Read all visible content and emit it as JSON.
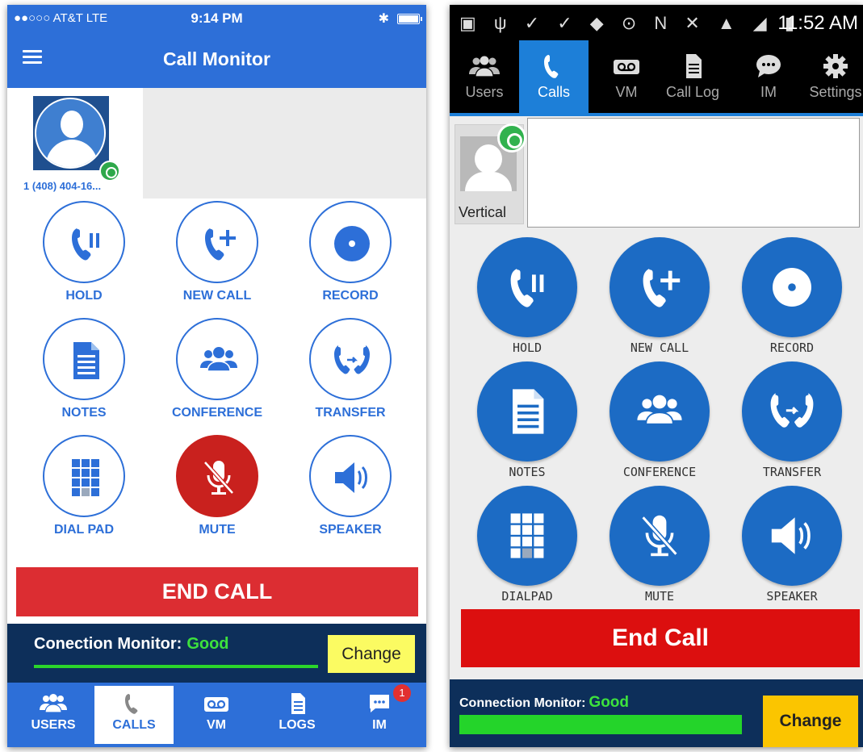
{
  "ios": {
    "status": {
      "carrier": "●●○○○ AT&T  LTE",
      "time": "9:14 PM",
      "bluetooth": "✱"
    },
    "nav": {
      "title": "Call Monitor"
    },
    "caller": {
      "number": "1 (408) 404-16..."
    },
    "buttons": [
      {
        "label": "HOLD",
        "icon": "phone-hold-icon"
      },
      {
        "label": "NEW CALL",
        "icon": "phone-add-icon"
      },
      {
        "label": "RECORD",
        "icon": "record-icon"
      },
      {
        "label": "NOTES",
        "icon": "notes-icon"
      },
      {
        "label": "CONFERENCE",
        "icon": "conference-icon"
      },
      {
        "label": "TRANSFER",
        "icon": "transfer-icon"
      },
      {
        "label": "DIAL PAD",
        "icon": "dialpad-icon"
      },
      {
        "label": "MUTE",
        "icon": "mic-muted-icon",
        "active": true
      },
      {
        "label": "SPEAKER",
        "icon": "speaker-icon"
      }
    ],
    "end_call": "END CALL",
    "connection": {
      "label": "Conection Monitor:",
      "status": "Good",
      "change": "Change"
    },
    "tabs": [
      {
        "label": "USERS",
        "icon": "users-icon"
      },
      {
        "label": "CALLS",
        "icon": "phone-icon",
        "active": true
      },
      {
        "label": "VM",
        "icon": "voicemail-icon"
      },
      {
        "label": "LOGS",
        "icon": "document-icon"
      },
      {
        "label": "IM",
        "icon": "chat-icon",
        "badge": "1"
      }
    ],
    "colors": {
      "primary": "#2d6fd8",
      "end_call": "#dc2d32",
      "mute_active": "#c9211e",
      "monitor_bg": "#0d2f5a",
      "good": "#3de23d",
      "change_bg": "#fbfb62"
    }
  },
  "android": {
    "status": {
      "time": "11:52 AM"
    },
    "tabs": [
      {
        "label": "Users",
        "icon": "users-icon"
      },
      {
        "label": "Calls",
        "icon": "phone-icon",
        "active": true
      },
      {
        "label": "VM",
        "icon": "voicemail-icon"
      },
      {
        "label": "Call Log",
        "icon": "document-icon"
      },
      {
        "label": "IM",
        "icon": "chat-icon"
      },
      {
        "label": "Settings",
        "icon": "gear-icon"
      }
    ],
    "caller": {
      "name": "Vertical"
    },
    "buttons": [
      {
        "label": "HOLD",
        "icon": "phone-hold-icon"
      },
      {
        "label": "NEW CALL",
        "icon": "phone-add-icon"
      },
      {
        "label": "RECORD",
        "icon": "record-icon"
      },
      {
        "label": "NOTES",
        "icon": "notes-icon"
      },
      {
        "label": "CONFERENCE",
        "icon": "conference-icon"
      },
      {
        "label": "TRANSFER",
        "icon": "transfer-icon"
      },
      {
        "label": "DIALPAD",
        "icon": "dialpad-icon"
      },
      {
        "label": "MUTE",
        "icon": "mic-muted-icon"
      },
      {
        "label": "SPEAKER",
        "icon": "speaker-icon"
      }
    ],
    "end_call": "End Call",
    "connection": {
      "label": "Connection Monitor:",
      "status": "Good",
      "change": "Change"
    },
    "colors": {
      "primary": "#1c6bc4",
      "tab_active": "#1d7fd8",
      "end_call": "#dc0f0f",
      "monitor_bg": "#0d2f5a",
      "good": "#3de23d",
      "change_bg": "#fbc500"
    }
  }
}
